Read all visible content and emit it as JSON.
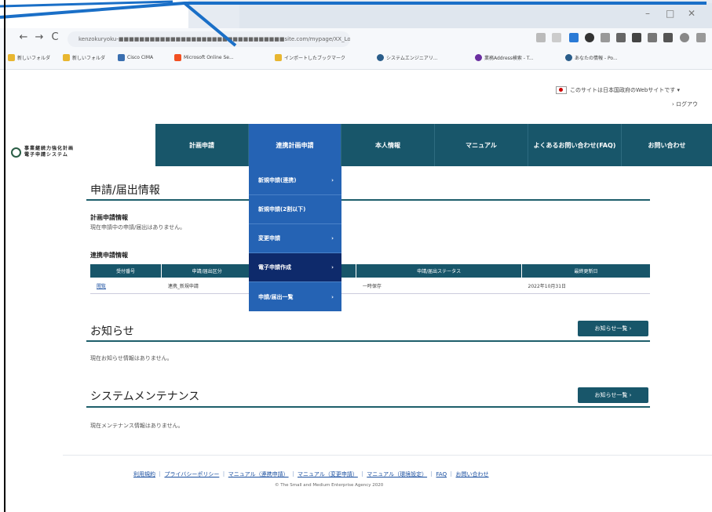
{
  "browser": {
    "window_controls": [
      "–",
      "□",
      "✕"
    ],
    "nav": {
      "back": "←",
      "forward": "→",
      "reload": "C"
    },
    "url": "kenzokuryoku-■■■■■■■■■■■■■■■■■■■■■■■■■■■■■■■■site.com/mypage/XX_Login/index",
    "bookmarks": [
      "新しいフォルダ",
      "新しいフォルダ",
      "Cisco CIMA",
      "Microsoft Online Se...",
      "インポートしたブックマーク",
      "システムエンジニアリ...",
      "業務Address検索 - T...",
      "あなたの情報 - Po..."
    ]
  },
  "page": {
    "gov_notice": "このサイトは日本国政府のWebサイトです ▾",
    "logout": "› ログアウ",
    "logo_text_line1": "事業継続力強化計画",
    "logo_text_line2": "電子申請システム",
    "main_nav": [
      "計画申請",
      "連携計画申請",
      "本人情報",
      "マニュアル",
      "よくあるお問い合わせ(FAQ)",
      "お問い合わせ"
    ],
    "dropdown": [
      "新規申請(連携)",
      "新規申請(2割以下)",
      "変更申請",
      "電子申請作成",
      "申請/届出一覧"
    ],
    "application_section": {
      "title": "申請/届出情報",
      "plan_header": "計画申請情報",
      "plan_none": "現在申請中の申請/届出はありません。",
      "linked_header": "連携申請情報",
      "table_headers": [
        "受付番号",
        "申請/届出区分",
        "",
        "申請/届出ステータス",
        "最終更新日"
      ],
      "table_rows": [
        [
          "閲覧",
          "連携_新規申請",
          "",
          "一時保存",
          "2022年10月31日"
        ]
      ]
    },
    "news": {
      "title": "お知らせ",
      "none": "現在お知らせ情報はありません。",
      "button": "お知らせ一覧 ›"
    },
    "maintenance": {
      "title": "システムメンテナンス",
      "none": "現在メンテナンス情報はありません。",
      "button": "お知らせ一覧 ›"
    },
    "footer_links": [
      "利用規約",
      "プライバシーポリシー",
      "マニュアル（連携申請）",
      "マニュアル（変更申請）",
      "マニュアル（環境設定）",
      "FAQ",
      "お問い合わせ"
    ],
    "copyright": "© The Small and Medium Enterprise Agency 2020"
  },
  "colors": {
    "nav": "#18566a",
    "active": "#2563b4",
    "dropdown_dark": "#0e2a6b",
    "annotation": "#1a6fc7"
  }
}
